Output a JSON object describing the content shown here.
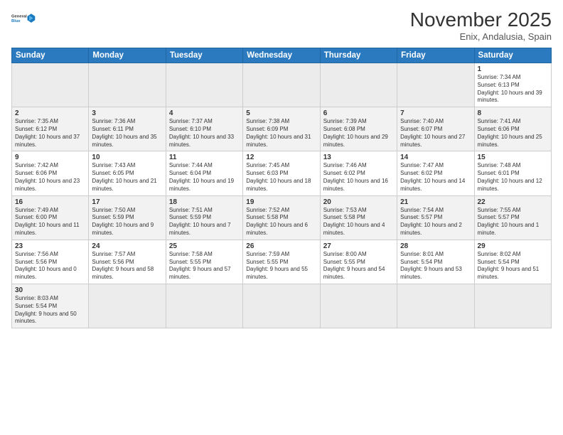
{
  "logo": {
    "text_general": "General",
    "text_blue": "Blue"
  },
  "title": "November 2025",
  "location": "Enix, Andalusia, Spain",
  "days_of_week": [
    "Sunday",
    "Monday",
    "Tuesday",
    "Wednesday",
    "Thursday",
    "Friday",
    "Saturday"
  ],
  "weeks": [
    [
      {
        "day": "",
        "info": ""
      },
      {
        "day": "",
        "info": ""
      },
      {
        "day": "",
        "info": ""
      },
      {
        "day": "",
        "info": ""
      },
      {
        "day": "",
        "info": ""
      },
      {
        "day": "",
        "info": ""
      },
      {
        "day": "1",
        "info": "Sunrise: 7:34 AM\nSunset: 6:13 PM\nDaylight: 10 hours and 39 minutes."
      }
    ],
    [
      {
        "day": "2",
        "info": "Sunrise: 7:35 AM\nSunset: 6:12 PM\nDaylight: 10 hours and 37 minutes."
      },
      {
        "day": "3",
        "info": "Sunrise: 7:36 AM\nSunset: 6:11 PM\nDaylight: 10 hours and 35 minutes."
      },
      {
        "day": "4",
        "info": "Sunrise: 7:37 AM\nSunset: 6:10 PM\nDaylight: 10 hours and 33 minutes."
      },
      {
        "day": "5",
        "info": "Sunrise: 7:38 AM\nSunset: 6:09 PM\nDaylight: 10 hours and 31 minutes."
      },
      {
        "day": "6",
        "info": "Sunrise: 7:39 AM\nSunset: 6:08 PM\nDaylight: 10 hours and 29 minutes."
      },
      {
        "day": "7",
        "info": "Sunrise: 7:40 AM\nSunset: 6:07 PM\nDaylight: 10 hours and 27 minutes."
      },
      {
        "day": "8",
        "info": "Sunrise: 7:41 AM\nSunset: 6:06 PM\nDaylight: 10 hours and 25 minutes."
      }
    ],
    [
      {
        "day": "9",
        "info": "Sunrise: 7:42 AM\nSunset: 6:06 PM\nDaylight: 10 hours and 23 minutes."
      },
      {
        "day": "10",
        "info": "Sunrise: 7:43 AM\nSunset: 6:05 PM\nDaylight: 10 hours and 21 minutes."
      },
      {
        "day": "11",
        "info": "Sunrise: 7:44 AM\nSunset: 6:04 PM\nDaylight: 10 hours and 19 minutes."
      },
      {
        "day": "12",
        "info": "Sunrise: 7:45 AM\nSunset: 6:03 PM\nDaylight: 10 hours and 18 minutes."
      },
      {
        "day": "13",
        "info": "Sunrise: 7:46 AM\nSunset: 6:02 PM\nDaylight: 10 hours and 16 minutes."
      },
      {
        "day": "14",
        "info": "Sunrise: 7:47 AM\nSunset: 6:02 PM\nDaylight: 10 hours and 14 minutes."
      },
      {
        "day": "15",
        "info": "Sunrise: 7:48 AM\nSunset: 6:01 PM\nDaylight: 10 hours and 12 minutes."
      }
    ],
    [
      {
        "day": "16",
        "info": "Sunrise: 7:49 AM\nSunset: 6:00 PM\nDaylight: 10 hours and 11 minutes."
      },
      {
        "day": "17",
        "info": "Sunrise: 7:50 AM\nSunset: 5:59 PM\nDaylight: 10 hours and 9 minutes."
      },
      {
        "day": "18",
        "info": "Sunrise: 7:51 AM\nSunset: 5:59 PM\nDaylight: 10 hours and 7 minutes."
      },
      {
        "day": "19",
        "info": "Sunrise: 7:52 AM\nSunset: 5:58 PM\nDaylight: 10 hours and 6 minutes."
      },
      {
        "day": "20",
        "info": "Sunrise: 7:53 AM\nSunset: 5:58 PM\nDaylight: 10 hours and 4 minutes."
      },
      {
        "day": "21",
        "info": "Sunrise: 7:54 AM\nSunset: 5:57 PM\nDaylight: 10 hours and 2 minutes."
      },
      {
        "day": "22",
        "info": "Sunrise: 7:55 AM\nSunset: 5:57 PM\nDaylight: 10 hours and 1 minute."
      }
    ],
    [
      {
        "day": "23",
        "info": "Sunrise: 7:56 AM\nSunset: 5:56 PM\nDaylight: 10 hours and 0 minutes."
      },
      {
        "day": "24",
        "info": "Sunrise: 7:57 AM\nSunset: 5:56 PM\nDaylight: 9 hours and 58 minutes."
      },
      {
        "day": "25",
        "info": "Sunrise: 7:58 AM\nSunset: 5:55 PM\nDaylight: 9 hours and 57 minutes."
      },
      {
        "day": "26",
        "info": "Sunrise: 7:59 AM\nSunset: 5:55 PM\nDaylight: 9 hours and 55 minutes."
      },
      {
        "day": "27",
        "info": "Sunrise: 8:00 AM\nSunset: 5:55 PM\nDaylight: 9 hours and 54 minutes."
      },
      {
        "day": "28",
        "info": "Sunrise: 8:01 AM\nSunset: 5:54 PM\nDaylight: 9 hours and 53 minutes."
      },
      {
        "day": "29",
        "info": "Sunrise: 8:02 AM\nSunset: 5:54 PM\nDaylight: 9 hours and 51 minutes."
      }
    ],
    [
      {
        "day": "30",
        "info": "Sunrise: 8:03 AM\nSunset: 5:54 PM\nDaylight: 9 hours and 50 minutes."
      },
      {
        "day": "",
        "info": ""
      },
      {
        "day": "",
        "info": ""
      },
      {
        "day": "",
        "info": ""
      },
      {
        "day": "",
        "info": ""
      },
      {
        "day": "",
        "info": ""
      },
      {
        "day": "",
        "info": ""
      }
    ]
  ]
}
